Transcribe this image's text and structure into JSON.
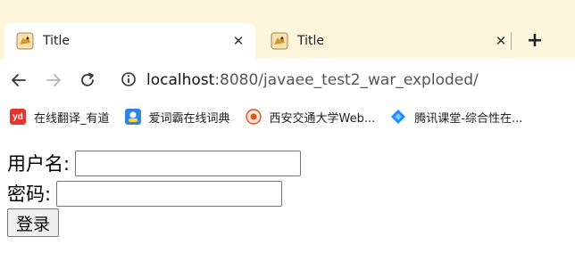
{
  "tabs": [
    {
      "title": "Title",
      "active": true
    },
    {
      "title": "Title",
      "active": false
    }
  ],
  "toolbar": {
    "url_host": "localhost",
    "url_rest": ":8080/javaee_test2_war_exploded/"
  },
  "bookmarks": [
    {
      "label": "在线翻译_有道",
      "icon": "youdao-icon",
      "badge": "yd"
    },
    {
      "label": "爱词霸在线词典",
      "icon": "iciba-icon"
    },
    {
      "label": "西安交通大学Web...",
      "icon": "xjtu-icon"
    },
    {
      "label": "腾讯课堂-综合性在...",
      "icon": "tencent-classroom-icon"
    }
  ],
  "form": {
    "username_label": "用户名:",
    "username_value": "",
    "password_label": "密码:",
    "password_value": "",
    "submit_label": "登录"
  },
  "colors": {
    "tabstrip_bg": "#fdf6dd",
    "youdao_red": "#e8322c",
    "iciba_blue": "#2e86de",
    "tencent_blue": "#1a8cff"
  }
}
